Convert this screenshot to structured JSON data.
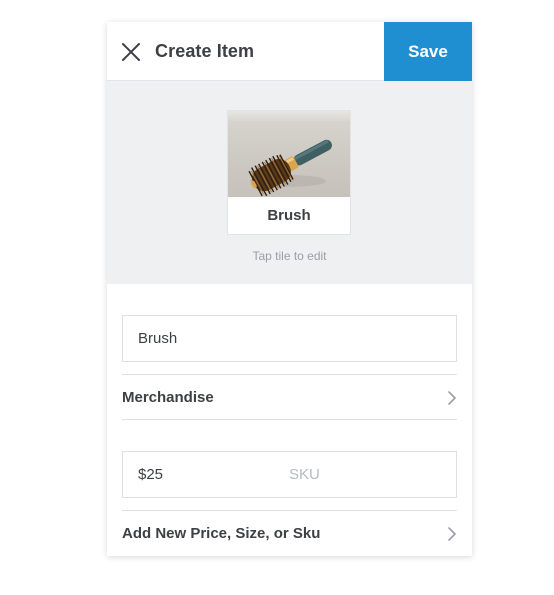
{
  "header": {
    "title": "Create Item",
    "save_label": "Save",
    "close_icon": "close-icon"
  },
  "tile": {
    "label": "Brush",
    "image": "brush-photo",
    "hint": "Tap tile to edit"
  },
  "form": {
    "name_value": "Brush",
    "category_label": "Merchandise",
    "price_value": "$25",
    "sku_placeholder": "SKU",
    "add_variant_label": "Add New Price, Size, or Sku"
  },
  "colors": {
    "accent": "#1f8fd1",
    "tile_background": "#eef0f2",
    "text": "#3d4044",
    "muted": "#9aa0a6"
  }
}
